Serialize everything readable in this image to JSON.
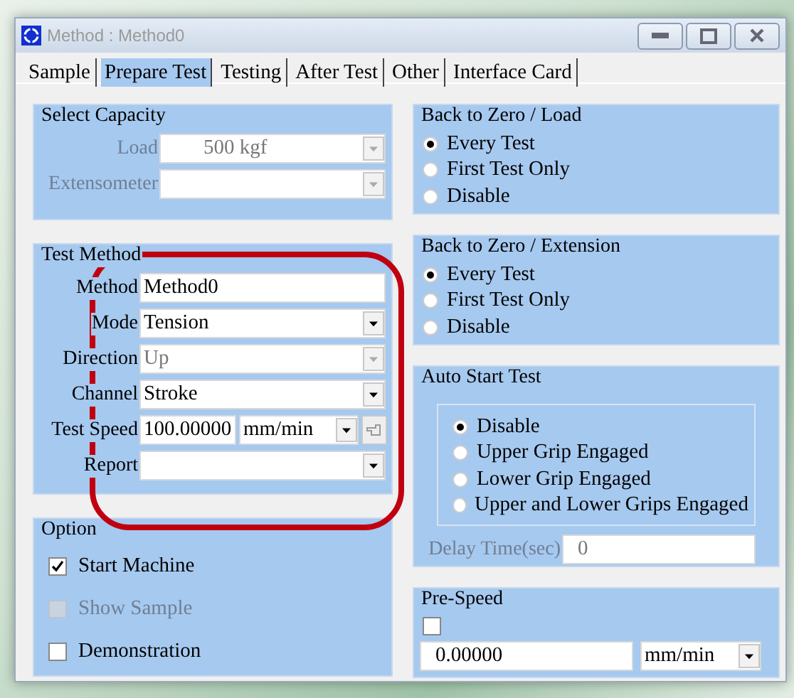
{
  "window": {
    "title": "Method :  Method0"
  },
  "tabs": [
    {
      "label": "Sample",
      "selected": false
    },
    {
      "label": "Prepare Test",
      "selected": true
    },
    {
      "label": "Testing",
      "selected": false
    },
    {
      "label": "After Test",
      "selected": false
    },
    {
      "label": "Other",
      "selected": false
    },
    {
      "label": "Interface Card",
      "selected": false
    }
  ],
  "select_capacity": {
    "title": "Select Capacity",
    "fields": [
      {
        "label": "Load",
        "value": "500 kgf",
        "disabled": true
      },
      {
        "label": "Extensometer",
        "disabled": true
      }
    ]
  },
  "test_method": {
    "title": "Test Method",
    "fields": [
      {
        "kind": "text",
        "label": "Method",
        "value": "Method0"
      },
      {
        "kind": "dropdown",
        "label": "Mode",
        "value": "Tension",
        "disabled": false
      },
      {
        "kind": "dropdown",
        "label": "Direction",
        "value": "Up",
        "disabled": true
      },
      {
        "kind": "dropdown",
        "label": "Channel",
        "value": "Stroke",
        "disabled": false
      },
      {
        "kind": "speed",
        "label": "Test Speed",
        "value": "100.00000",
        "unit": "mm/min"
      },
      {
        "kind": "dropdown",
        "label": "Report",
        "disabled": false
      }
    ]
  },
  "option": {
    "title": "Option",
    "items": [
      {
        "label": "Start Machine",
        "checked": true,
        "disabled": false
      },
      {
        "label": "Show Sample",
        "checked": false,
        "disabled": true
      },
      {
        "label": "Demonstration",
        "checked": false,
        "disabled": false
      }
    ]
  },
  "back_to_zero_load": {
    "title": "Back to Zero / Load",
    "options": [
      {
        "label": "Every Test",
        "selected": true
      },
      {
        "label": "First Test Only",
        "selected": false
      },
      {
        "label": "Disable",
        "selected": false
      }
    ]
  },
  "back_to_zero_extension": {
    "title": "Back to Zero / Extension",
    "options": [
      {
        "label": "Every Test",
        "selected": true
      },
      {
        "label": "First Test Only",
        "selected": false
      },
      {
        "label": "Disable",
        "selected": false
      }
    ]
  },
  "auto_start_test": {
    "title": "Auto Start Test",
    "options": [
      {
        "label": "Disable",
        "selected": true
      },
      {
        "label": "Upper Grip Engaged",
        "selected": false
      },
      {
        "label": "Lower Grip Engaged",
        "selected": false
      },
      {
        "label": "Upper and Lower Grips Engaged",
        "selected": false
      }
    ],
    "delay": {
      "label": "Delay Time(sec)",
      "value": "0",
      "disabled": true
    }
  },
  "pre_speed": {
    "title": "Pre-Speed",
    "checked": false,
    "value": "0.00000",
    "unit": "mm/min"
  }
}
